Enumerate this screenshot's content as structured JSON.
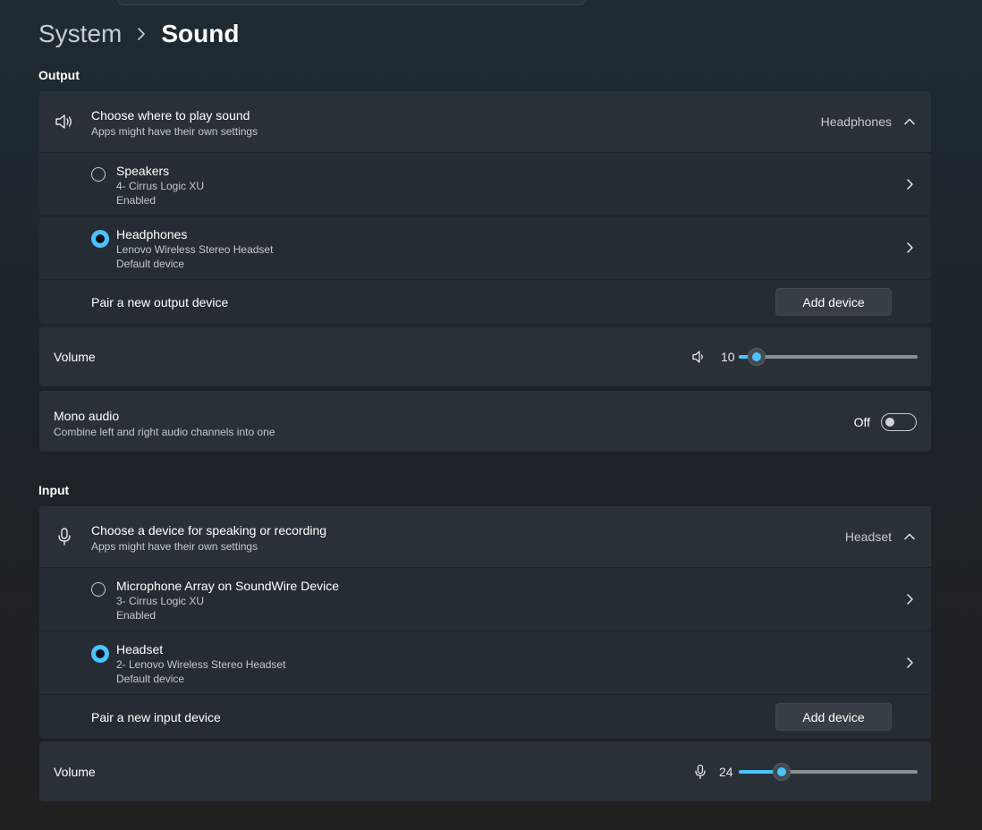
{
  "breadcrumb": {
    "parent": "System",
    "current": "Sound"
  },
  "output": {
    "title": "Output",
    "chooser": {
      "title": "Choose where to play sound",
      "subtitle": "Apps might have their own settings",
      "value": "Headphones",
      "icon": "speaker-icon"
    },
    "devices": [
      {
        "name": "Speakers",
        "model": "4- Cirrus Logic XU",
        "status": "Enabled",
        "selected": false
      },
      {
        "name": "Headphones",
        "model": "Lenovo Wireless Stereo Headset",
        "status": "Default device",
        "selected": true
      }
    ],
    "pair": {
      "label": "Pair a new output device",
      "button": "Add device"
    },
    "volume": {
      "label": "Volume",
      "value": "10",
      "level": 0.1,
      "icon": "speaker-icon"
    },
    "mono": {
      "title": "Mono audio",
      "subtitle": "Combine left and right audio channels into one",
      "state": "Off",
      "on": false
    }
  },
  "input": {
    "title": "Input",
    "chooser": {
      "title": "Choose a device for speaking or recording",
      "subtitle": "Apps might have their own settings",
      "value": "Headset",
      "icon": "microphone-icon"
    },
    "devices": [
      {
        "name": "Microphone Array on SoundWire Device",
        "model": "3- Cirrus Logic XU",
        "status": "Enabled",
        "selected": false
      },
      {
        "name": "Headset",
        "model": "2- Lenovo Wireless Stereo Headset",
        "status": "Default device",
        "selected": true
      }
    ],
    "pair": {
      "label": "Pair a new input device",
      "button": "Add device"
    },
    "volume": {
      "label": "Volume",
      "value": "24",
      "level": 0.24,
      "icon": "microphone-icon"
    }
  },
  "colors": {
    "accent": "#4cc2ff",
    "card": "#2a3038",
    "background": "#1f2a33"
  }
}
